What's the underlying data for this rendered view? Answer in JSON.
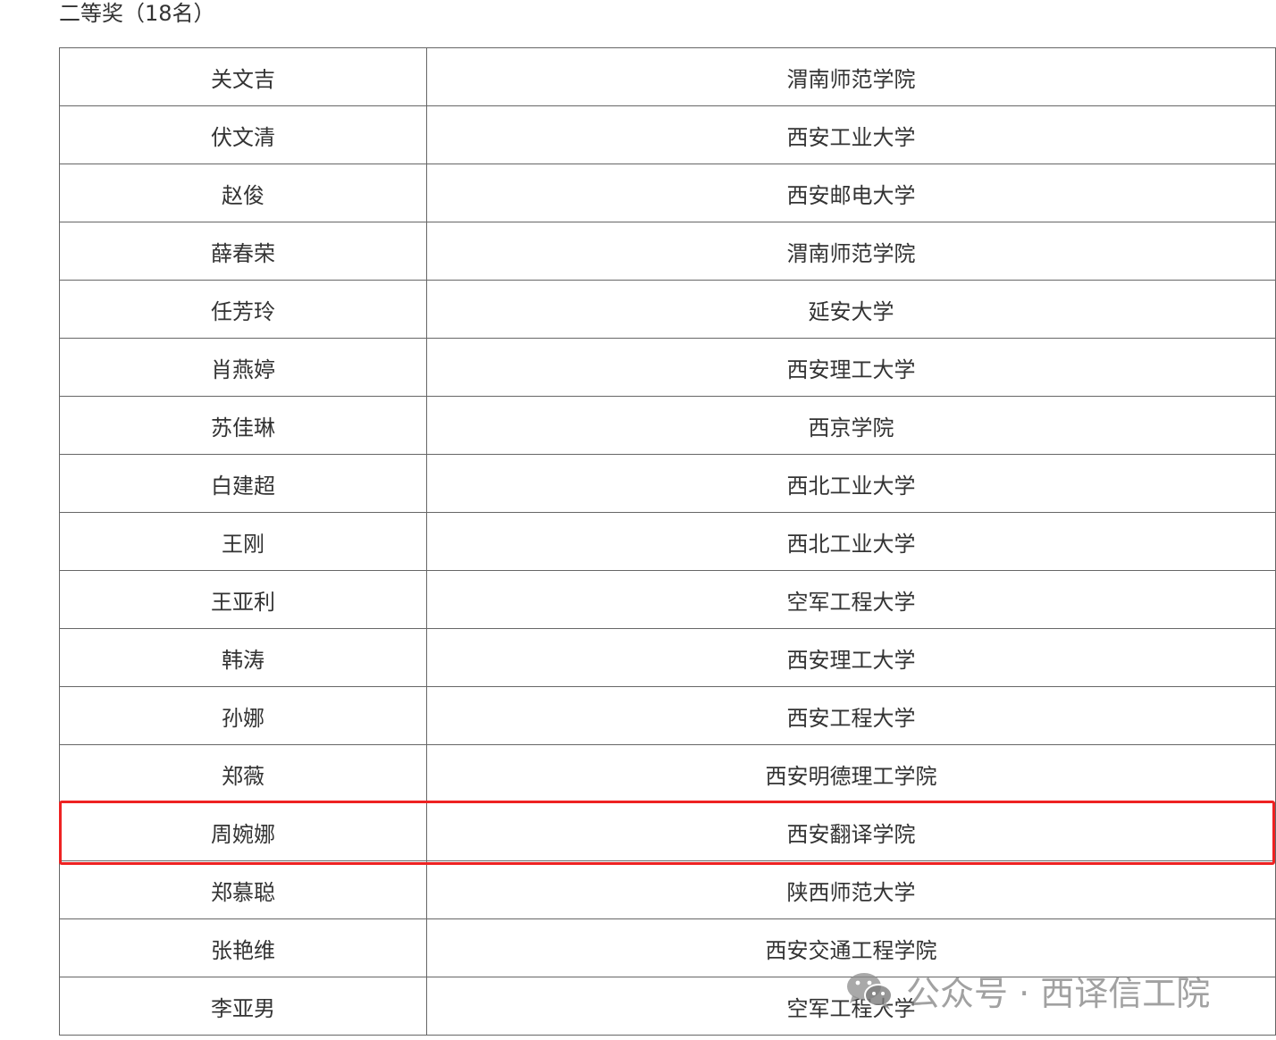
{
  "section": {
    "title": "二等奖（18名）"
  },
  "table": {
    "rows": [
      {
        "name": "关文吉",
        "school": "渭南师范学院"
      },
      {
        "name": "伏文清",
        "school": "西安工业大学"
      },
      {
        "name": "赵俊",
        "school": "西安邮电大学"
      },
      {
        "name": "薛春荣",
        "school": "渭南师范学院"
      },
      {
        "name": "任芳玲",
        "school": "延安大学"
      },
      {
        "name": "肖燕婷",
        "school": "西安理工大学"
      },
      {
        "name": "苏佳琳",
        "school": "西京学院"
      },
      {
        "name": "白建超",
        "school": "西北工业大学"
      },
      {
        "name": "王刚",
        "school": "西北工业大学"
      },
      {
        "name": "王亚利",
        "school": "空军工程大学"
      },
      {
        "name": "韩涛",
        "school": "西安理工大学"
      },
      {
        "name": "孙娜",
        "school": "西安工程大学"
      },
      {
        "name": "郑薇",
        "school": "西安明德理工学院"
      },
      {
        "name": "周婉娜",
        "school": "西安翻译学院"
      },
      {
        "name": "郑慕聪",
        "school": "陕西师范大学"
      },
      {
        "name": "张艳维",
        "school": "西安交通工程学院"
      },
      {
        "name": "李亚男",
        "school": "空军工程大学"
      }
    ],
    "highlighted_row_index": 13,
    "highlight_color": "#ee2222"
  },
  "watermark": {
    "icon": "wechat-icon",
    "text": "公众号 · 西译信工院"
  }
}
